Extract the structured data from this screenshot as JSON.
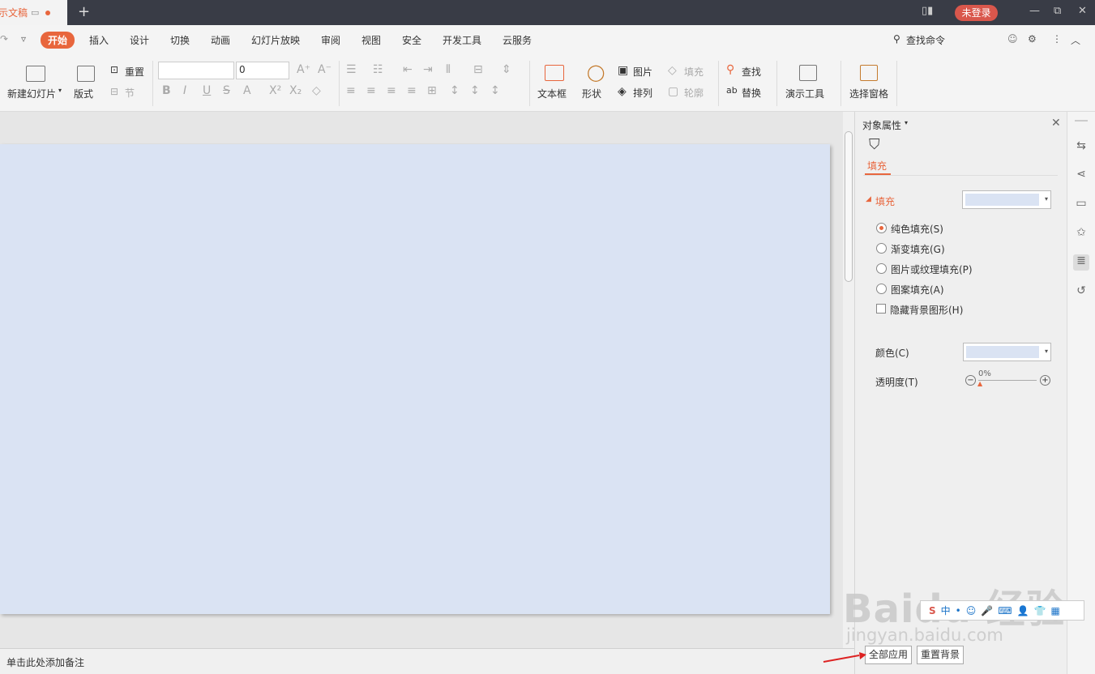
{
  "titlebar": {
    "tab_title": "示文稿",
    "new_tab": "+",
    "login": "未登录"
  },
  "menu": {
    "items": [
      "开始",
      "插入",
      "设计",
      "切换",
      "动画",
      "幻灯片放映",
      "审阅",
      "视图",
      "安全",
      "开发工具",
      "云服务"
    ],
    "search": "查找命令"
  },
  "ribbon": {
    "new_slide": "新建幻灯片",
    "layout": "版式",
    "reset": "重置",
    "section": "节",
    "font_size": "0",
    "textbox": "文本框",
    "shape": "形状",
    "picture": "图片",
    "arrange": "排列",
    "fill": "填充",
    "outline": "轮廓",
    "find": "查找",
    "replace": "替换",
    "presenter": "演示工具",
    "select_pane": "选择窗格"
  },
  "notes": {
    "placeholder": "单击此处添加备注"
  },
  "panel": {
    "title": "对象属性",
    "tab_fill": "填充",
    "section_fill": "填充",
    "options": [
      "纯色填充(S)",
      "渐变填充(G)",
      "图片或纹理填充(P)",
      "图案填充(A)"
    ],
    "selected_option": 0,
    "hide_bg": "隐藏背景图形(H)",
    "color_label": "颜色(C)",
    "transparency_label": "透明度(T)",
    "transparency_value": "0%",
    "apply_all": "全部应用",
    "reset_bg": "重置背景",
    "swatch_color": "#dae3f3"
  },
  "watermark": {
    "brand": "Baidu 经验",
    "url": "jingyan.baidu.com"
  },
  "colors": {
    "accent": "#e8663d",
    "titlebar": "#393c46",
    "slide": "#dae3f3"
  }
}
